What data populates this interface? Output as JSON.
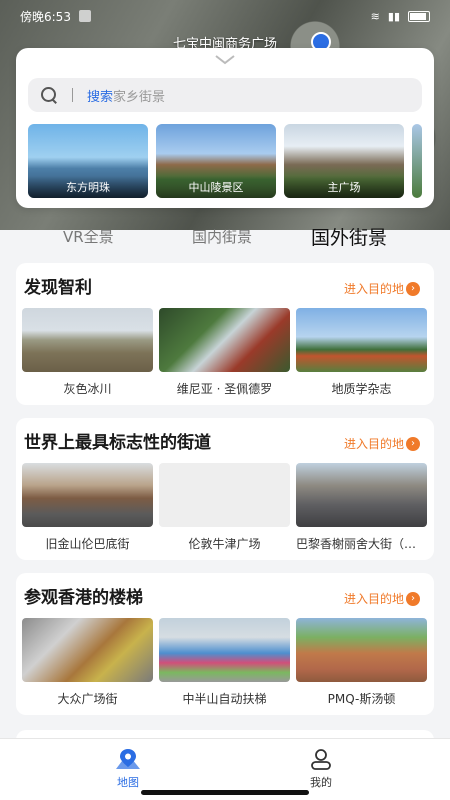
{
  "status_bar": {
    "time": "傍晚6:53"
  },
  "location": {
    "name": "七宝中闽商务广场"
  },
  "search": {
    "highlight": "搜索",
    "placeholder": "家乡街景"
  },
  "featured": [
    {
      "label": "东方明珠"
    },
    {
      "label": "中山陵景区"
    },
    {
      "label": "主广场"
    }
  ],
  "tabs": [
    {
      "label": "VR全景",
      "active": false
    },
    {
      "label": "国内街景",
      "active": false
    },
    {
      "label": "国外街景",
      "active": true
    }
  ],
  "sections": [
    {
      "title": "发现智利",
      "link": "进入目的地",
      "items": [
        {
          "caption": "灰色冰川"
        },
        {
          "caption": "维尼亚 · 圣佩德罗"
        },
        {
          "caption": "地质学杂志"
        }
      ]
    },
    {
      "title": "世界上最具标志性的街道",
      "link": "进入目的地",
      "items": [
        {
          "caption": "旧金山伦巴底街"
        },
        {
          "caption": "伦敦牛津广场"
        },
        {
          "caption": "巴黎香榭丽舍大街（法国）"
        }
      ]
    },
    {
      "title": "参观香港的楼梯",
      "link": "进入目的地",
      "items": [
        {
          "caption": "大众广场街"
        },
        {
          "caption": "中半山自动扶梯"
        },
        {
          "caption": "PMQ-斯汤顿"
        }
      ]
    }
  ],
  "nav": {
    "map": "地图",
    "mine": "我的"
  },
  "colors": {
    "accent": "#2b6de3",
    "link": "#f07a2a"
  }
}
